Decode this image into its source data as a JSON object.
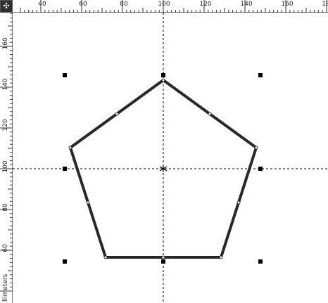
{
  "rulers": {
    "horizontal_labels": [
      "40",
      "60",
      "80",
      "100",
      "120",
      "140",
      "160",
      "18"
    ],
    "vertical_labels": [
      "160",
      "140",
      "120",
      "100",
      "80",
      "60"
    ],
    "units": "llimeters"
  },
  "corner_icon": "crosshair-origin-icon",
  "colors": {
    "outline": "#2b2627",
    "handle": "#000000",
    "guide": "#000000",
    "ruler_bg": "#ffffff"
  },
  "shape": {
    "type": "pentagon",
    "selected": true
  }
}
